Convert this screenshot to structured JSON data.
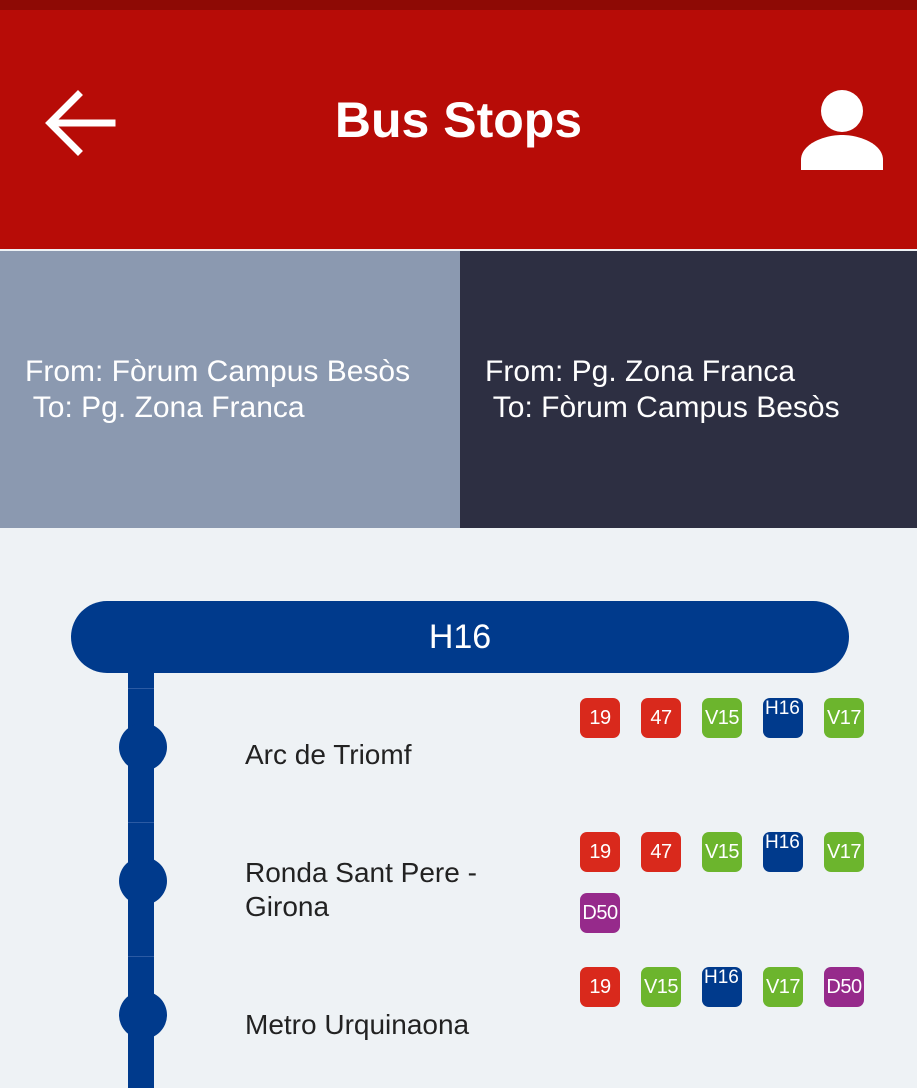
{
  "app_bar": {
    "title": "Bus Stops",
    "back_icon": "arrow-back-icon",
    "profile_icon": "person-icon",
    "color": "#b70c07"
  },
  "tabs": [
    {
      "from": "From: Fòrum Campus Besòs",
      "to": " To: Pg. Zona Franca",
      "selected": false,
      "color": "#8b99b0"
    },
    {
      "from": "From: Pg. Zona Franca",
      "to": " To: Fòrum Campus Besòs",
      "selected": true,
      "color": "#2d2f42"
    }
  ],
  "route": {
    "name": "H16",
    "color": "#003a8c"
  },
  "line_colors": {
    "red": "#d9291c",
    "green": "#6cb52d",
    "blue": "#003a8c",
    "purple": "#962a8b"
  },
  "stops": [
    {
      "name": "Arc de Triomf",
      "lines": [
        {
          "label": "19",
          "color": "#d9291c"
        },
        {
          "label": "47",
          "color": "#d9291c"
        },
        {
          "label": "V15",
          "color": "#6cb52d"
        },
        {
          "label": "H16",
          "color": "#003a8c"
        },
        {
          "label": "V17",
          "color": "#6cb52d"
        }
      ]
    },
    {
      "name": "Ronda Sant Pere - Girona",
      "lines": [
        {
          "label": "19",
          "color": "#d9291c"
        },
        {
          "label": "47",
          "color": "#d9291c"
        },
        {
          "label": "V15",
          "color": "#6cb52d"
        },
        {
          "label": "H16",
          "color": "#003a8c"
        },
        {
          "label": "V17",
          "color": "#6cb52d"
        },
        {
          "label": "D50",
          "color": "#962a8b"
        }
      ]
    },
    {
      "name": "Metro Urquinaona",
      "lines": [
        {
          "label": "19",
          "color": "#d9291c"
        },
        {
          "label": "V15",
          "color": "#6cb52d"
        },
        {
          "label": "H16",
          "color": "#003a8c"
        },
        {
          "label": "V17",
          "color": "#6cb52d"
        },
        {
          "label": "D50",
          "color": "#962a8b"
        }
      ]
    }
  ]
}
